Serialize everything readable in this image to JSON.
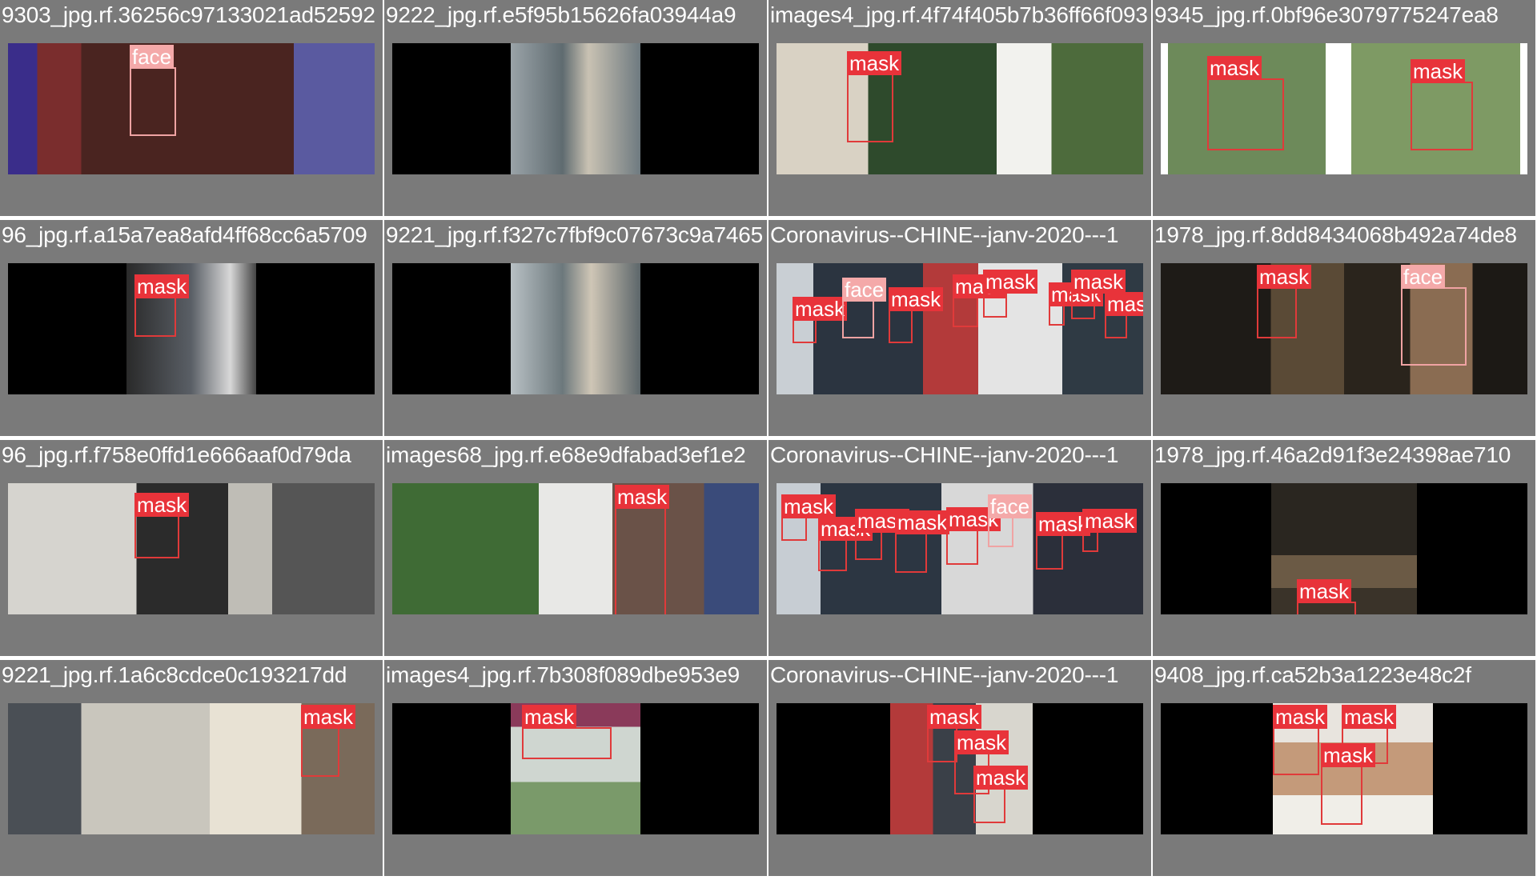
{
  "window": {
    "title": ""
  },
  "colors": {
    "mask": "#e8333a",
    "face": "#f4a9a9",
    "panel_bg": "#7a7a7a"
  },
  "panels": [
    {
      "title": "9303_jpg.rf.36256c97133021ad52592",
      "labels": [
        "face"
      ]
    },
    {
      "title": "9222_jpg.rf.e5f95b15626fa03944a9",
      "labels": []
    },
    {
      "title": "images4_jpg.rf.4f74f405b7b36ff66f093",
      "labels": [
        "mask"
      ]
    },
    {
      "title": "9345_jpg.rf.0bf96e3079775247ea8",
      "labels": [
        "mask",
        "mask"
      ]
    },
    {
      "title": "96_jpg.rf.a15a7ea8afd4ff68cc6a5709",
      "labels": [
        "mask"
      ]
    },
    {
      "title": "9221_jpg.rf.f327c7fbf9c07673c9a7465",
      "labels": []
    },
    {
      "title": "Coronavirus--CHINE--janv-2020---1",
      "labels": [
        "mask",
        "face",
        "mask",
        "mask",
        "mask",
        "mask",
        "mask",
        "mask"
      ]
    },
    {
      "title": "1978_jpg.rf.8dd8434068b492a74de8",
      "labels": [
        "mask",
        "face"
      ]
    },
    {
      "title": "96_jpg.rf.f758e0ffd1e666aaf0d79da",
      "labels": [
        "mask"
      ]
    },
    {
      "title": "images68_jpg.rf.e68e9dfabad3ef1e2",
      "labels": [
        "mask"
      ]
    },
    {
      "title": "Coronavirus--CHINE--janv-2020---1",
      "labels": [
        "mask",
        "mask",
        "mask",
        "mask",
        "mask",
        "face",
        "mask",
        "mask"
      ]
    },
    {
      "title": "1978_jpg.rf.46a2d91f3e24398ae710",
      "labels": [
        "mask"
      ]
    },
    {
      "title": "9221_jpg.rf.1a6c8cdce0c193217dd",
      "labels": [
        "mask"
      ]
    },
    {
      "title": "images4_jpg.rf.7b308f089dbe953e9",
      "labels": [
        "mask"
      ]
    },
    {
      "title": "Coronavirus--CHINE--janv-2020---1",
      "labels": [
        "mask",
        "mask",
        "mask"
      ]
    },
    {
      "title": "9408_jpg.rf.ca52b3a1223e48c2f",
      "labels": [
        "mask",
        "mask",
        "mask"
      ]
    }
  ]
}
